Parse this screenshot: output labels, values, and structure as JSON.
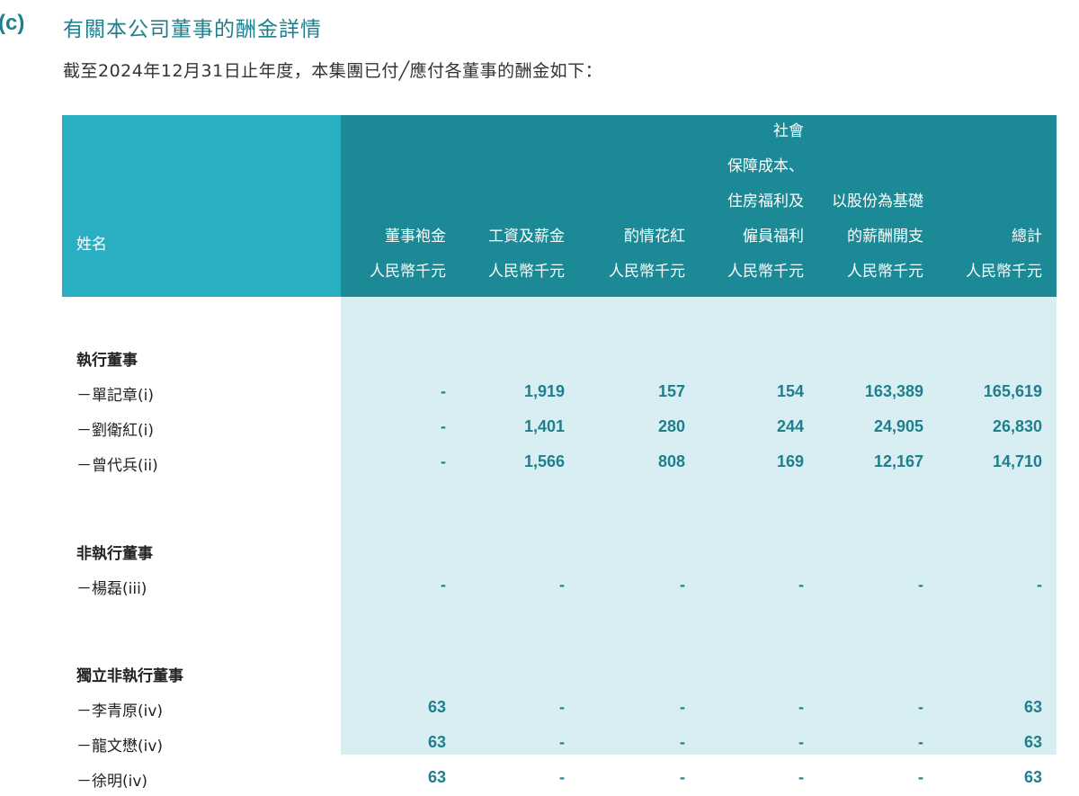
{
  "section": {
    "label": "(c)",
    "title": "有關本公司董事的酬金詳情",
    "intro": "截至2024年12月31日止年度，本集團已付╱應付各董事的酬金如下："
  },
  "table": {
    "name_header": "姓名",
    "columns": [
      {
        "lines": [
          "董事袍金"
        ],
        "unit": "人民幣千元"
      },
      {
        "lines": [
          "工資及薪金"
        ],
        "unit": "人民幣千元"
      },
      {
        "lines": [
          "酌情花紅"
        ],
        "unit": "人民幣千元"
      },
      {
        "lines": [
          "社會",
          "保障成本、",
          "住房福利及",
          "僱員福利"
        ],
        "unit": "人民幣千元"
      },
      {
        "lines": [
          "以股份為基礎",
          "的薪酬開支"
        ],
        "unit": "人民幣千元"
      },
      {
        "lines": [
          "總計"
        ],
        "unit": "人民幣千元"
      }
    ],
    "groups": [
      {
        "category": "執行董事",
        "rows": [
          {
            "name": "－單記章(i)",
            "values": [
              "-",
              "1,919",
              "157",
              "154",
              "163,389",
              "165,619"
            ]
          },
          {
            "name": "－劉衛紅(i)",
            "values": [
              "-",
              "1,401",
              "280",
              "244",
              "24,905",
              "26,830"
            ]
          },
          {
            "name": "－曾代兵(ii)",
            "values": [
              "-",
              "1,566",
              "808",
              "169",
              "12,167",
              "14,710"
            ]
          }
        ]
      },
      {
        "category": "非執行董事",
        "rows": [
          {
            "name": "－楊磊(iii)",
            "values": [
              "-",
              "-",
              "-",
              "-",
              "-",
              "-"
            ]
          }
        ]
      },
      {
        "category": "獨立非執行董事",
        "rows": [
          {
            "name": "－李青原(iv)",
            "values": [
              "63",
              "-",
              "-",
              "-",
              "-",
              "63"
            ]
          },
          {
            "name": "－龍文懋(iv)",
            "values": [
              "63",
              "-",
              "-",
              "-",
              "-",
              "63"
            ]
          },
          {
            "name": "－徐明(iv)",
            "values": [
              "63",
              "-",
              "-",
              "-",
              "-",
              "63"
            ]
          }
        ]
      }
    ]
  }
}
